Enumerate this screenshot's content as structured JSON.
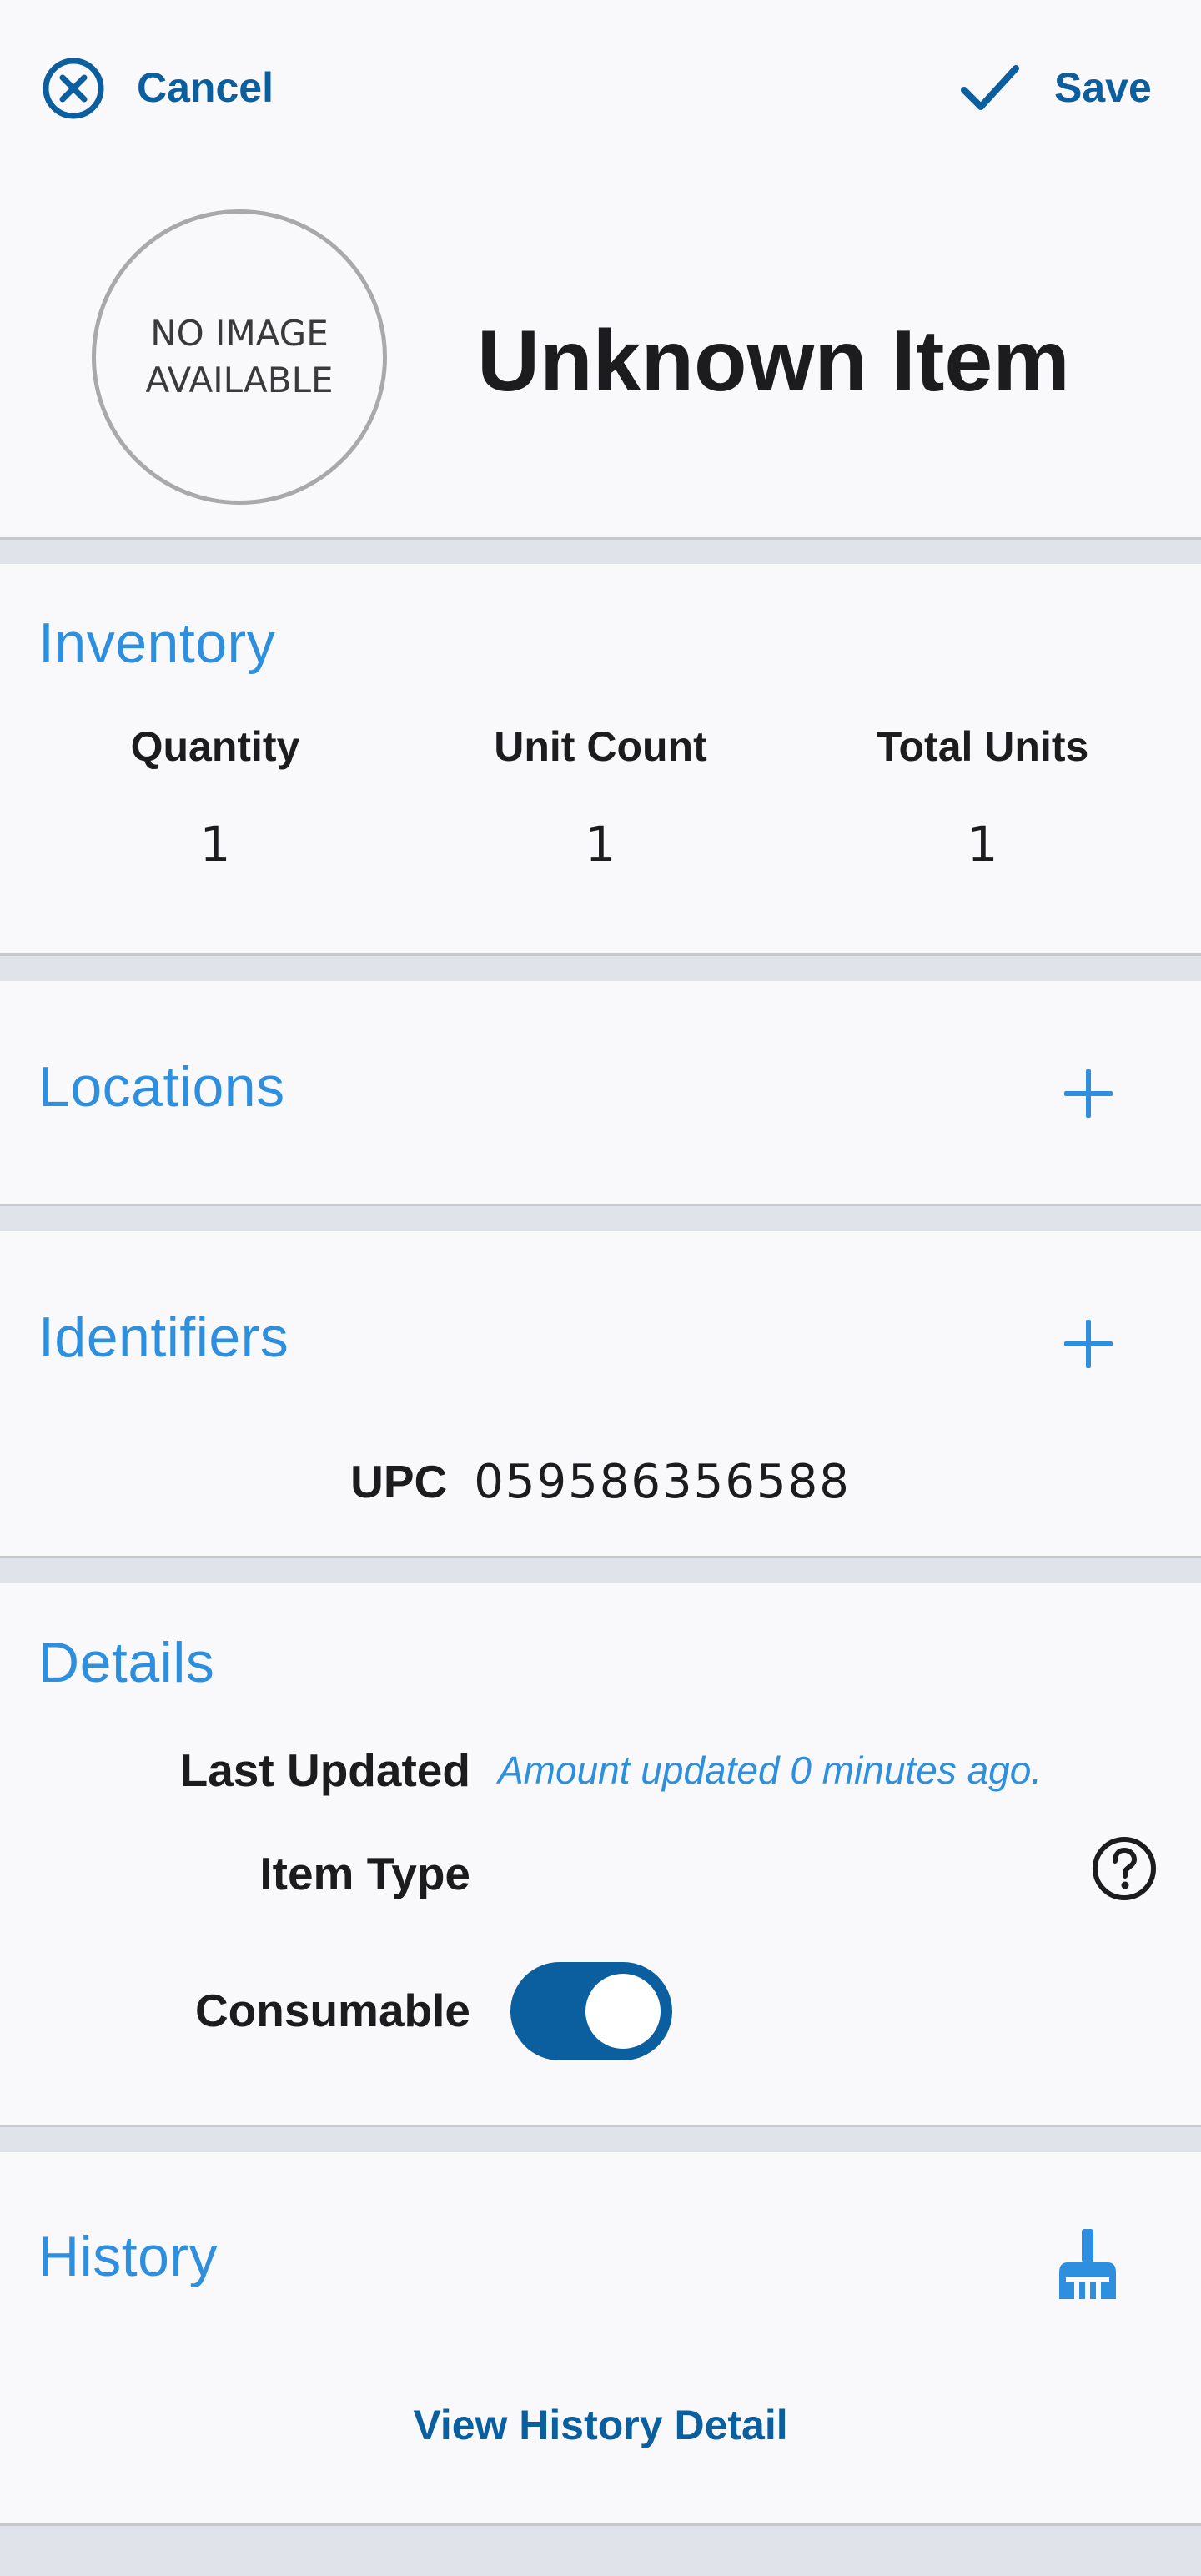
{
  "header": {
    "cancel_label": "Cancel",
    "save_label": "Save",
    "cancel_icon": "close-circle-icon",
    "save_icon": "check-icon"
  },
  "item": {
    "no_image_text": "NO IMAGE AVAILABLE",
    "title": "Unknown Item"
  },
  "inventory": {
    "title": "Inventory",
    "columns": [
      {
        "label": "Quantity",
        "value": "1"
      },
      {
        "label": "Unit Count",
        "value": "1"
      },
      {
        "label": "Total Units",
        "value": "1"
      }
    ]
  },
  "locations": {
    "title": "Locations",
    "add_icon": "plus-icon"
  },
  "identifiers": {
    "title": "Identifiers",
    "add_icon": "plus-icon",
    "type": "UPC",
    "value": "059586356588"
  },
  "details": {
    "title": "Details",
    "last_updated_label": "Last Updated",
    "last_updated_value": "Amount updated 0 minutes ago.",
    "item_type_label": "Item Type",
    "help_icon": "help-circle-icon",
    "consumable_label": "Consumable",
    "consumable_on": true
  },
  "history": {
    "title": "History",
    "clear_icon": "broom-icon",
    "view_detail_label": "View History Detail"
  },
  "colors": {
    "accent": "#2d8fdd",
    "primary": "#0b5f9e",
    "card_bg": "#f9f9fc",
    "page_bg": "#e1e3ea"
  }
}
